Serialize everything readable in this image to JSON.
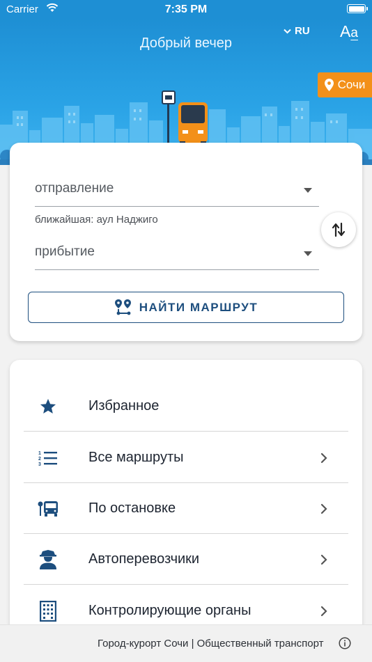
{
  "status_bar": {
    "carrier": "Carrier",
    "time": "7:35 PM"
  },
  "header": {
    "greeting": "Добрый вечер",
    "language": "RU",
    "font_size_label_big": "A",
    "font_size_label_small": "a",
    "city": "Сочи"
  },
  "route_form": {
    "departure_placeholder": "отправление",
    "nearest_stop": "ближайшая: аул Наджиго",
    "arrival_placeholder": "прибытие",
    "find_button": "НАЙТИ МАРШРУТ"
  },
  "menu": {
    "items": [
      {
        "label": "Избранное",
        "icon": "star-icon",
        "has_chevron": false
      },
      {
        "label": "Все маршруты",
        "icon": "numbered-list-icon",
        "has_chevron": true
      },
      {
        "label": "По остановке",
        "icon": "bus-stop-icon",
        "has_chevron": true
      },
      {
        "label": "Автоперевозчики",
        "icon": "driver-icon",
        "has_chevron": true
      },
      {
        "label": "Контролирующие органы",
        "icon": "building-icon",
        "has_chevron": true
      }
    ]
  },
  "footer": {
    "text": "Город-курорт Сочи | Общественный транспорт"
  },
  "colors": {
    "header_blue": "#1e8fd4",
    "accent_orange": "#f39019",
    "primary_dark_blue": "#1d4e7e"
  }
}
